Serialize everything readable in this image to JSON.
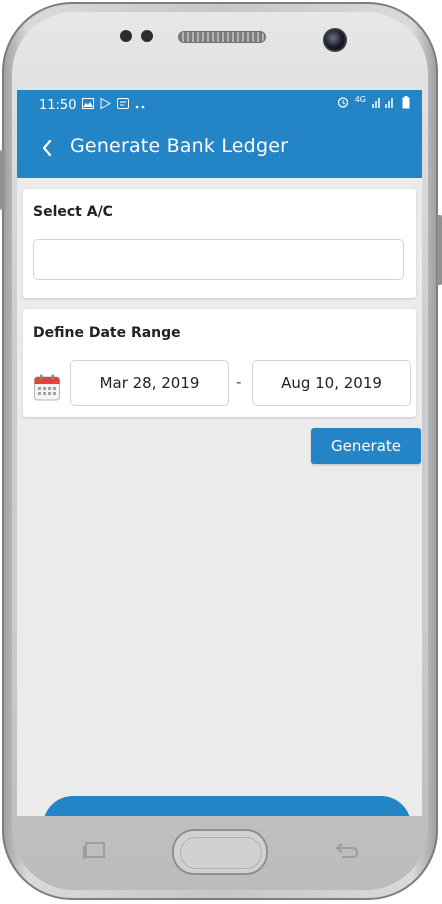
{
  "status_bar": {
    "time": "11:50",
    "network": "4G"
  },
  "app_bar": {
    "title": "Generate Bank Ledger"
  },
  "account_card": {
    "label": "Select A/C",
    "value": "",
    "placeholder": ""
  },
  "date_card": {
    "label": "Define Date Range",
    "from_date": "Mar 28, 2019",
    "separator": "-",
    "to_date": "Aug 10, 2019"
  },
  "actions": {
    "generate_label": "Generate"
  },
  "colors": {
    "primary": "#2385c6",
    "background": "#ebebeb",
    "card": "#ffffff"
  },
  "icons": [
    "back-arrow-icon",
    "calendar-icon",
    "gallery-icon",
    "play-store-icon",
    "message-icon",
    "alarm-icon",
    "signal-icon",
    "battery-icon"
  ]
}
